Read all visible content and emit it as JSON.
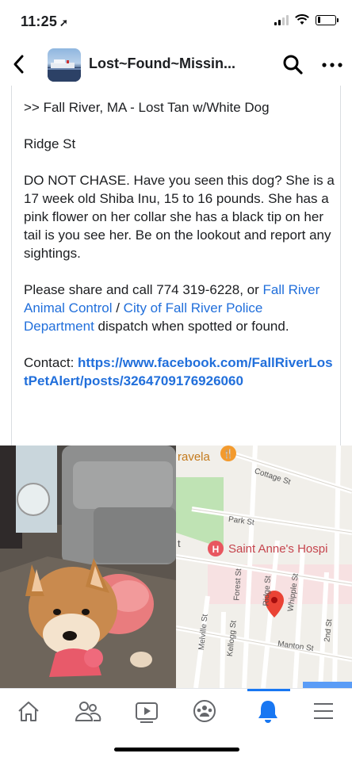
{
  "status_bar": {
    "time": "11:25",
    "location_icon": "location-arrow-icon",
    "battery_level": 0.15
  },
  "header": {
    "back_icon": "chevron-left-icon",
    "group_title": "Lost~Found~Missin...",
    "search_icon": "search-icon",
    "more_icon": "more-horizontal-icon"
  },
  "post": {
    "line1": ">>  Fall River, MA - Lost Tan w/White Dog",
    "line2": "Ridge St",
    "paragraph1": "DO NOT CHASE.  Have you seen this dog? She is a 17 week old Shiba Inu, 15 to 16 pounds.  She has a pink flower on her collar she has a black tip on her tail is you see her. Be on the lookout and report any sightings.",
    "share_prefix": "Please share and call 774 319-6228, or ",
    "share_link1": "Fall River Animal Control",
    "share_sep": " / ",
    "share_link2": "City of Fall River Police Department",
    "share_suffix": " dispatch when spotted or found.",
    "contact_label": "Contact:  ",
    "contact_url": "https://www.facebook.com/FallRiverLostPetAlert/posts/3264709176926060"
  },
  "map": {
    "labels": {
      "ravela": "ravela",
      "cottage": "Cottage St",
      "park": "Park St",
      "hospital": "Saint Anne's Hospi",
      "forest": "Forest St",
      "ridge": "Ridge St",
      "whipple": "Whipple St",
      "melville": "Melville St",
      "kellogg": "Kellogg St",
      "manton": "Manton St",
      "second": "2nd St",
      "t": "t"
    }
  },
  "bottom_nav": {
    "items": [
      {
        "icon": "home-icon",
        "active": false
      },
      {
        "icon": "friends-icon",
        "active": false
      },
      {
        "icon": "watch-icon",
        "active": false
      },
      {
        "icon": "groups-icon",
        "active": false
      },
      {
        "icon": "notifications-bell-icon",
        "active": true
      },
      {
        "icon": "menu-icon",
        "active": false
      }
    ]
  },
  "colors": {
    "link": "#216fdb",
    "active": "#1877f2"
  }
}
